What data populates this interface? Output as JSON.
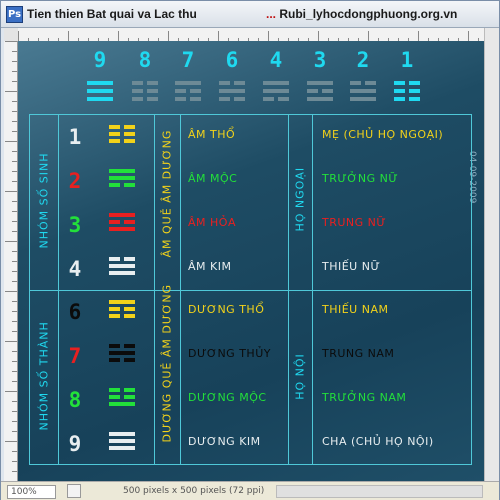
{
  "window": {
    "title_main": "Tien thien Bat quai va Lac thu",
    "title_file": "Rubi_lyhocdongphuong.org.vn",
    "title_ellipsis": "...",
    "app_icon": "Ps"
  },
  "status": {
    "zoom": "100%",
    "info": "500 pixels x 500 pixels (72 ppi)"
  },
  "date_stamp": "04-09-2009",
  "colors": {
    "cyan": "#1fd9f0",
    "yellow": "#f2d21a",
    "red": "#e82020",
    "green": "#22e03a",
    "white": "#e8eef0",
    "black": "#0b0b0b",
    "gray": "#6d8a96",
    "table_line": "#4fc8d8"
  },
  "top_numbers": [
    "9",
    "8",
    "7",
    "6",
    "4",
    "3",
    "2",
    "1"
  ],
  "top_trigrams": [
    {
      "lines": [
        1,
        1,
        1
      ],
      "color": "cyan"
    },
    {
      "lines": [
        0,
        0,
        0
      ],
      "color": "gray"
    },
    {
      "lines": [
        1,
        0,
        0
      ],
      "color": "gray"
    },
    {
      "lines": [
        0,
        1,
        0
      ],
      "color": "gray"
    },
    {
      "lines": [
        1,
        1,
        0
      ],
      "color": "gray"
    },
    {
      "lines": [
        1,
        0,
        1
      ],
      "color": "gray"
    },
    {
      "lines": [
        0,
        1,
        1
      ],
      "color": "gray"
    },
    {
      "lines": [
        0,
        0,
        0
      ],
      "color": "cyan"
    }
  ],
  "table": {
    "group_sinh": "NHÓM SỐ SINH",
    "group_thanh": "NHÓM SỐ THÀNH",
    "am_group": "ÂM QUẺ ÂM DƯƠNG",
    "duong_group": "DƯƠNG QUẺ ÂM DƯƠNG",
    "ho_ngoai": "HỌ NGOẠI",
    "ho_noi": "HỌ NỘI",
    "rows": [
      {
        "num": "1",
        "num_color": "white",
        "trigram": [
          0,
          0,
          0
        ],
        "sym_color": "yellow",
        "element": "Âm thổ",
        "el_color": "yellow",
        "family": "Mẹ (chủ họ ngoại)",
        "fam_color": "yellow"
      },
      {
        "num": "2",
        "num_color": "red",
        "trigram": [
          1,
          1,
          0
        ],
        "sym_color": "green",
        "element": "Âm mộc",
        "el_color": "green",
        "family": "Trưởng nữ",
        "fam_color": "green"
      },
      {
        "num": "3",
        "num_color": "green",
        "trigram": [
          1,
          0,
          1
        ],
        "sym_color": "red",
        "element": "Âm hỏa",
        "el_color": "red",
        "family": "Trung nữ",
        "fam_color": "red"
      },
      {
        "num": "4",
        "num_color": "white",
        "trigram": [
          0,
          1,
          1
        ],
        "sym_color": "white",
        "element": "Âm kim",
        "el_color": "white",
        "family": "Thiếu nữ",
        "fam_color": "white"
      },
      {
        "num": "6",
        "num_color": "black",
        "trigram": [
          1,
          0,
          0
        ],
        "sym_color": "yellow",
        "element": "Dương thổ",
        "el_color": "yellow",
        "family": "Thiếu nam",
        "fam_color": "yellow"
      },
      {
        "num": "7",
        "num_color": "red",
        "trigram": [
          0,
          1,
          0
        ],
        "sym_color": "black",
        "element": "Dương thủy",
        "el_color": "black",
        "family": "Trung nam",
        "fam_color": "black"
      },
      {
        "num": "8",
        "num_color": "green",
        "trigram": [
          0,
          0,
          1
        ],
        "sym_color": "green",
        "element": "Dương mộc",
        "el_color": "green",
        "family": "Trưởng nam",
        "fam_color": "green"
      },
      {
        "num": "9",
        "num_color": "white",
        "trigram": [
          1,
          1,
          1
        ],
        "sym_color": "white",
        "element": "Dương kim",
        "el_color": "white",
        "family": "Cha (chủ họ nội)",
        "fam_color": "white"
      }
    ]
  }
}
